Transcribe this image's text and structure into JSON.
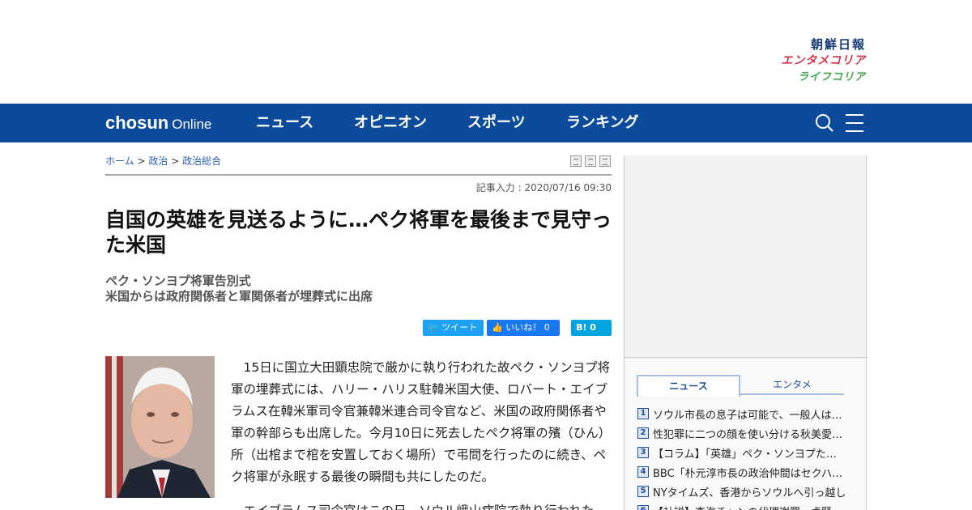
{
  "brands": {
    "chosun": "朝鮮日報",
    "entame": "エンタメコリア",
    "life": "ライフコリア"
  },
  "nav": {
    "logo_bold": "chosun",
    "logo_light": "Online",
    "items": [
      "ニュース",
      "オピニオン",
      "スポーツ",
      "ランキング"
    ]
  },
  "breadcrumb": {
    "home": "ホーム",
    "sep": ">",
    "level1": "政治",
    "level2": "政治総合"
  },
  "article": {
    "date": "記事入力 : 2020/07/16 09:30",
    "title": "自国の英雄を見送るように…ペク将軍を最後まで見守った米国",
    "subtitle_1": "ペク・ソンヨプ将軍告別式",
    "subtitle_2": "米国からは政府関係者と軍関係者が埋葬式に出席",
    "social": {
      "tweet": "ツイート",
      "like": "いいね！ 0",
      "hatena": "B! 0"
    },
    "paragraph_1": "15日に国立大田顕忠院で厳かに執り行われた故ペク・ソンヨプ将軍の埋葬式には、ハリー・ハリス駐韓米国大使、ロバート・エイブラムス在韓米軍司令官兼韓米連合司令官など、米国の政府関係者や軍の幹部らも出席した。今月10日に死去したペク将軍の殯（ひん）所（出棺まで棺を安置しておく場所）で弔問を行ったのに続き、ペク将軍が永眠する最後の瞬間も共にしたのだ。",
    "paragraph_2": "エイブラムス司令官はこの日、ソウル峨山病院で執り行われた"
  },
  "sidebar": {
    "tabs": [
      "ニュース",
      "エンタメ"
    ],
    "ranking": [
      {
        "rank": "1",
        "text": "ソウル市長の息子は可能で、一般人は…"
      },
      {
        "rank": "2",
        "text": "性犯罪に二つの顔を使い分ける秋美愛…"
      },
      {
        "rank": "3",
        "text": "【コラム】「英雄」ペク・ソンヨプた…"
      },
      {
        "rank": "4",
        "text": "BBC「朴元淳市長の政治仲間はセクハ…"
      },
      {
        "rank": "5",
        "text": "NYタイムズ、香港からソウルへ引っ越し"
      },
      {
        "rank": "6",
        "text": "【社説】李海チャンの代理謝罪、卓賢…"
      }
    ]
  },
  "colors": {
    "nav_bg": "#0c4a9c",
    "chosun_brand": "#1a3a7a",
    "entame_brand": "#d2334a",
    "life_brand": "#3aa94a"
  }
}
